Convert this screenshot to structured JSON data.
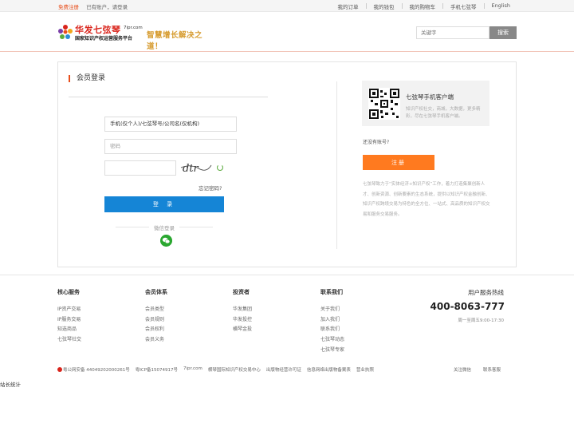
{
  "topbar": {
    "register": "免费注册",
    "has_account": "已有账户，请登录",
    "links": [
      "我的订单",
      "我的钱包",
      "我的购物车",
      "手机七弦琴",
      "English"
    ]
  },
  "header": {
    "logo_cn": "华发七弦琴",
    "logo_domain": "7ipr.com",
    "logo_sub": "国家知识产权运营服务平台",
    "slogan": "智慧增长解决之道！",
    "search_placeholder": "关键字",
    "search_button": "搜索"
  },
  "login": {
    "title": "会员登录",
    "user_placeholder": "手机(仅个人)/七弦琴号/公司名(仅机构)",
    "password_placeholder": "密码",
    "captcha_text": "dtr",
    "forgot": "忘记密码?",
    "login_button": "登 录",
    "wechat_label": "微信登录"
  },
  "app": {
    "title": "七弦琴手机客户端",
    "desc": "知识产权社交，商城，大数据，更多精彩，尽在七弦琴手机客户端。",
    "no_account": "还没有账号?",
    "register_button": "注册",
    "intro": "七弦琴致力于“实体经济+知识产权”工作，着力打造集聚创新人才、创新资源、创新要素的生态系统，提供以知识产权金融创新、知识产权跨境交易为特色的全方位、一站式、高品质的知识产权交易和服务交易服务。"
  },
  "footer": {
    "columns": [
      {
        "title": "核心服务",
        "items": [
          "IP资产交易",
          "IP服务交易",
          "知选商品",
          "七弦琴社交"
        ]
      },
      {
        "title": "会员体系",
        "items": [
          "会员类型",
          "会员规则",
          "会员权利",
          "会员义务"
        ]
      },
      {
        "title": "投资者",
        "items": [
          "华发集团",
          "华发投控",
          "横琴金投"
        ]
      },
      {
        "title": "联系我们",
        "items": [
          "关于我们",
          "加入我们",
          "联系我们",
          "七弦琴动态",
          "七弦琴专家"
        ]
      }
    ],
    "hotline_title": "用户服务热线",
    "hotline_number": "400-8063-777",
    "hotline_time": "周一至周五9:00-17:30",
    "bottom_links": [
      "粤公网安备 44049202000261号",
      "粤ICP备15074917号",
      "7ipr.com",
      "横琴国际知识产权交易中心",
      "出版物经营许可证",
      "信息网络出版物备案表",
      "营业执照"
    ],
    "right_links": [
      "关注微信",
      "联系客服"
    ],
    "stat": "站长统计"
  },
  "colors": {
    "accent_orange": "#e84f1c",
    "login_blue": "#1585d6",
    "register_orange": "#ff7a1f",
    "wechat_green": "#2aa730"
  }
}
